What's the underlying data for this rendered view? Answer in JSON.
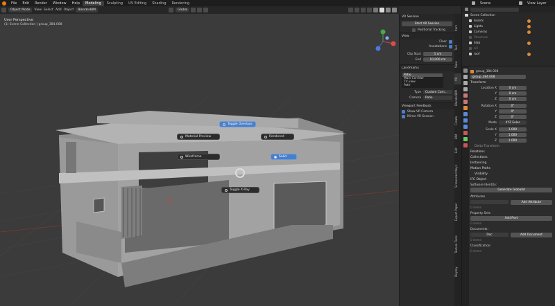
{
  "top_menu": {
    "items": [
      "File",
      "Edit",
      "Render",
      "Window",
      "Help"
    ],
    "workspaces": [
      "Modeling",
      "Sculpting",
      "UV Editing",
      "Shading",
      "Rendering"
    ],
    "scene_label": "Scene",
    "view_layer_label": "View Layer"
  },
  "header": {
    "mode": "Object Mode",
    "menus": [
      "View",
      "Select",
      "Add",
      "Object"
    ],
    "extra": "BlenderBIM",
    "transform": "Global"
  },
  "viewport": {
    "view_name": "User Perspective",
    "collection_path": "(1) Scene Collection | group_384.008",
    "buttons": {
      "toggle_overlays": "Toggle Overlays",
      "material_preview": "Material Preview",
      "rendered": "Rendered",
      "wireframe": "Wireframe",
      "solid": "Solid",
      "toggle_xray": "Toggle X-Ray"
    }
  },
  "npanel": {
    "vr_session_title": "VR Session",
    "start_vr": "Start VR Session",
    "positional_tracking": "Positional Tracking",
    "view_title": "View",
    "floor": "Floor",
    "annotations": "Annotations",
    "clip_start_label": "Clip Start",
    "clip_start": "1 cm",
    "clip_end_label": "End",
    "clip_end": "10,000 cm",
    "landmarks_title": "Landmarks",
    "landmarks": [
      "Patio",
      "Main Corridor",
      "TV view",
      "Path"
    ],
    "type_label": "Type",
    "type_value": "Custom Cam...",
    "camera_label": "Camera",
    "camera_value": "Patio",
    "viewport_feedback_title": "Viewport Feedback",
    "show_vr_camera": "Show VR Camera",
    "mirror_vr_session": "Mirror VR Session",
    "tabs": [
      "Item",
      "Tool",
      "View",
      "VR",
      "BlenderBIM",
      "Create",
      "BIM",
      "Edit",
      "Screencast Keys",
      "Export Paper",
      "Texture Tools",
      "Display"
    ]
  },
  "outliner": {
    "root": "Scene Collection",
    "rows": [
      "Assets",
      "Lights",
      "Cameras",
      "Structure",
      "Slab",
      "sill",
      "roof"
    ]
  },
  "properties": {
    "object_name": "group_384.008",
    "object_field": "group_384.008",
    "transform_title": "Transform",
    "location_x_label": "Location X",
    "location_y_label": "Y",
    "location_z_label": "Z",
    "location_x": "0 cm",
    "location_y": "0 cm",
    "location_z": "0 cm",
    "rotation_x_label": "Rotation X",
    "rotation_y_label": "Y",
    "rotation_z_label": "Z",
    "rotation_x": "0°",
    "rotation_y": "0°",
    "rotation_z": "0°",
    "mode_label": "Mode",
    "mode_value": "XYZ Euler",
    "scale_x_label": "Scale X",
    "scale_y_label": "Y",
    "scale_z_label": "Z",
    "scale_x": "1.000",
    "scale_y": "1.000",
    "scale_z": "1.000",
    "delta_transform": "Delta Transform",
    "sections": [
      "Relations",
      "Collections",
      "Instancing",
      "Motion Paths",
      "Visibility"
    ],
    "ifc_object_title": "IFC Object",
    "software_identity_label": "Software Identity:",
    "generate_guid": "Generate GlobalId",
    "attributes_label": "Attributes",
    "add_attribute": "Add Attribute",
    "property_sets_label": "Property Sets",
    "add_pset": "Add Pset",
    "documents_label": "Documents:",
    "documents_value": "Doc",
    "add_document": "Add Document",
    "classification_label": "Classification:",
    "items_count": "0 items"
  }
}
